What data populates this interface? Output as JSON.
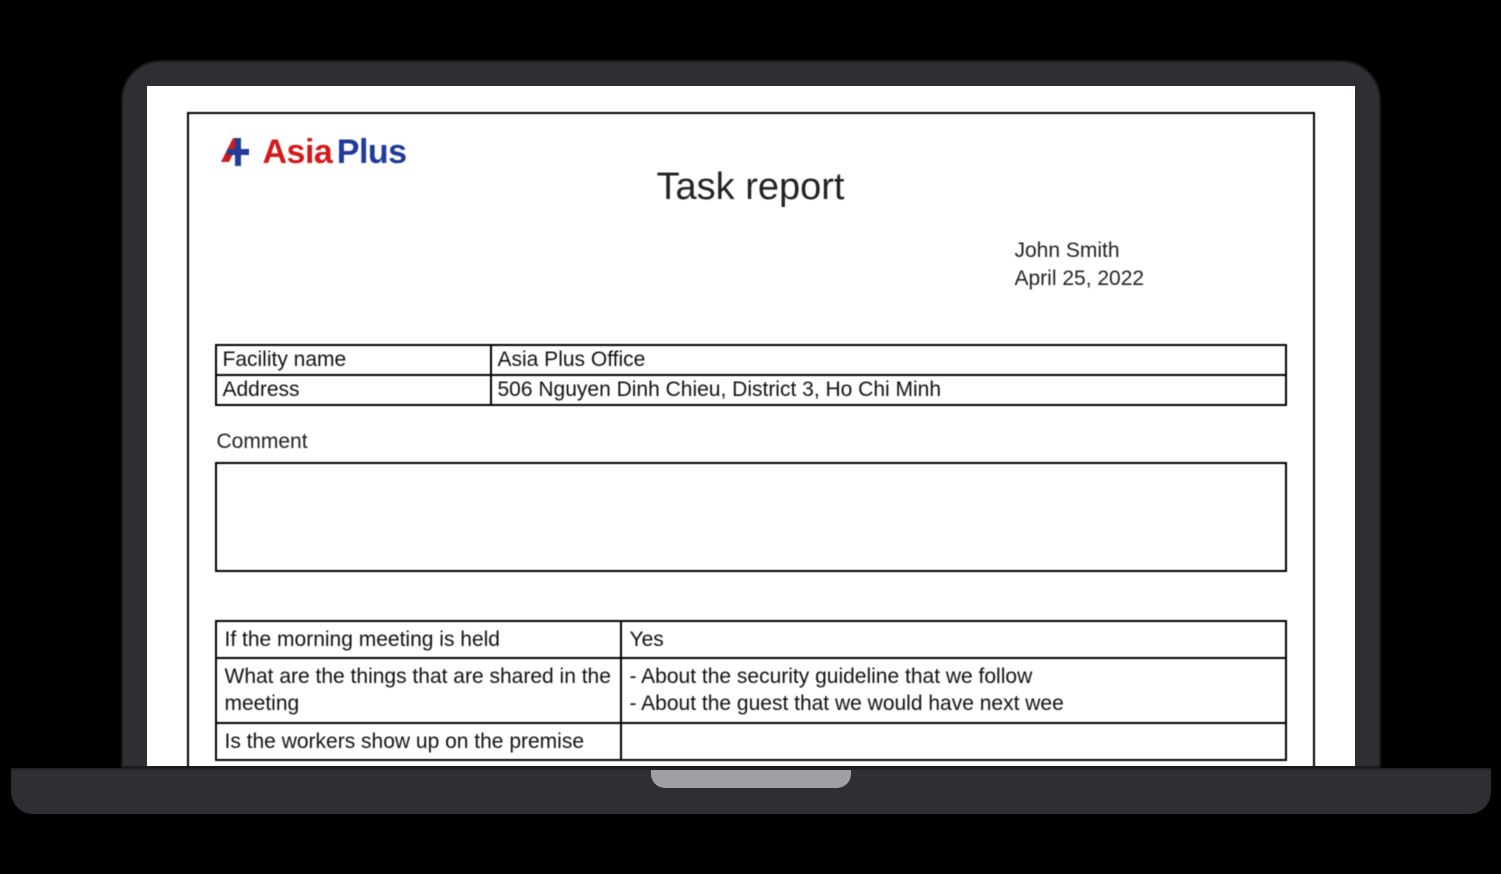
{
  "logo": {
    "word1": "Asia",
    "word2": "Plus"
  },
  "title": "Task report",
  "meta": {
    "name": "John Smith",
    "date": "April 25, 2022"
  },
  "info": {
    "rows": [
      {
        "label": "Facility name",
        "value": "Asia Plus Office"
      },
      {
        "label": "Address",
        "value": "506 Nguyen Dinh Chieu, District 3, Ho Chi Minh"
      }
    ]
  },
  "comment": {
    "label": "Comment",
    "value": ""
  },
  "qa": {
    "rows": [
      {
        "q": "If the morning meeting is held",
        "a": "Yes"
      },
      {
        "q": "What are the things that are shared in the meeting",
        "a": "- About the security guideline that we follow\n- About the guest that we would have next wee"
      },
      {
        "q": "Is the workers show up on the premise",
        "a": ""
      }
    ]
  }
}
